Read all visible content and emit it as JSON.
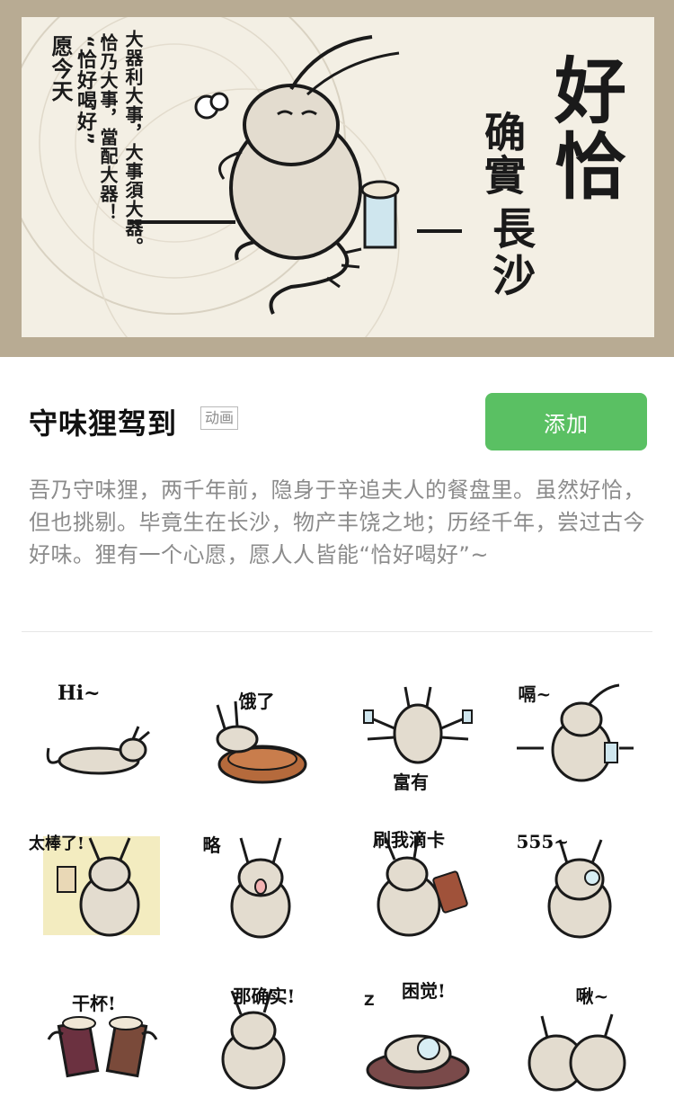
{
  "banner": {
    "wish_line1": "愿今天",
    "wish_line2": "“恰好喝好”",
    "quote_line1": "恰乃大事，當配大器！",
    "quote_line2": "大器利大事，大事須大器。",
    "big_text": "好恰",
    "sub_text_real": "确實",
    "sub_text_city": "長沙"
  },
  "header": {
    "title": "守味狸驾到",
    "tag": "动画",
    "add_button": "添加"
  },
  "description": "吾乃守味狸，两千年前，隐身于辛追夫人的餐盘里。虽然好恰，但也挑剔。毕竟生在长沙，物产丰饶之地；历经千年，尝过古今好味。狸有一个心愿，愿人人皆能“恰好喝好”~",
  "stickers": [
    {
      "caption": "Hi~",
      "icon": "waving-raccoon-icon"
    },
    {
      "caption": "饿了",
      "icon": "empty-plate-raccoon-icon"
    },
    {
      "caption": "富有",
      "icon": "rich-raccoon-icon"
    },
    {
      "caption": "嗝~",
      "icon": "burping-raccoon-icon"
    },
    {
      "caption": "太棒了!",
      "icon": "cheering-raccoon-icon"
    },
    {
      "caption": "略",
      "icon": "tongue-raccoon-icon"
    },
    {
      "caption": "刷我滴卡",
      "icon": "card-raccoon-icon"
    },
    {
      "caption": "555~",
      "icon": "crying-raccoon-icon"
    },
    {
      "caption": "干杯!",
      "icon": "cheers-drinks-icon"
    },
    {
      "caption": "那确实!",
      "icon": "agreeing-raccoon-icon"
    },
    {
      "caption": "困觉!",
      "icon": "sleeping-raccoon-icon"
    },
    {
      "caption": "啾~",
      "icon": "kissing-raccoons-icon"
    }
  ],
  "colors": {
    "banner_frame": "#b8ab93",
    "banner_paper": "#f3efe4",
    "add_button": "#5ac063",
    "description_text": "#8b8b8b",
    "raccoon_fill": "#e3dccf",
    "ink": "#1a1a1a"
  }
}
